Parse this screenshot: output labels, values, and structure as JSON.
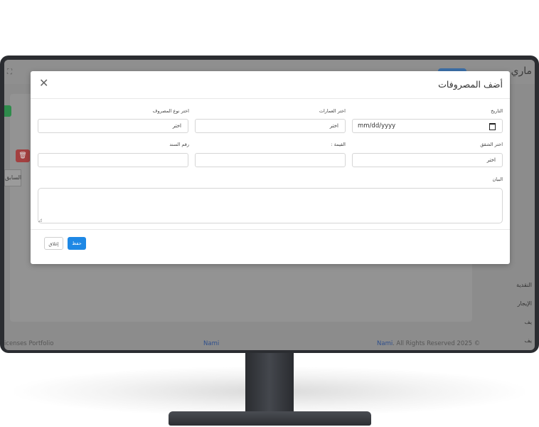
{
  "background_app": {
    "title": "ماري",
    "expand_icon": "expand-icon",
    "delete_icon": "trash-icon",
    "prev_button_label": "السابق",
    "side_items": [
      "النقدية",
      "الإيجار",
      "يف",
      "يف"
    ],
    "footer": {
      "left_text": "icenses  Portfolio",
      "center_brand": "Nami",
      "right_brand": "Nami",
      "right_text": ". All Rights Reserved 2025 ©"
    }
  },
  "modal": {
    "title": "أضف المصروفات",
    "close_icon": "close-icon",
    "fields": {
      "date_label": "التاريخ",
      "date_placeholder": "mm/dd/yyyy",
      "property_label": "اختر العمارات",
      "property_value": "اختر",
      "expense_type_label": "اختر نوع المصروف",
      "expense_type_value": "اختر",
      "apartment_label": "اختر الشقق",
      "apartment_value": "اختر",
      "amount_label": "القيمة :",
      "voucher_label": "رقم السند",
      "statement_label": "البيان"
    },
    "buttons": {
      "save": "حفظ",
      "cancel": "إغلاق"
    }
  },
  "colors": {
    "primary": "#1e88e5",
    "danger": "#a34040",
    "success": "#2e8b4b",
    "overlay": "#8c8c8c"
  }
}
